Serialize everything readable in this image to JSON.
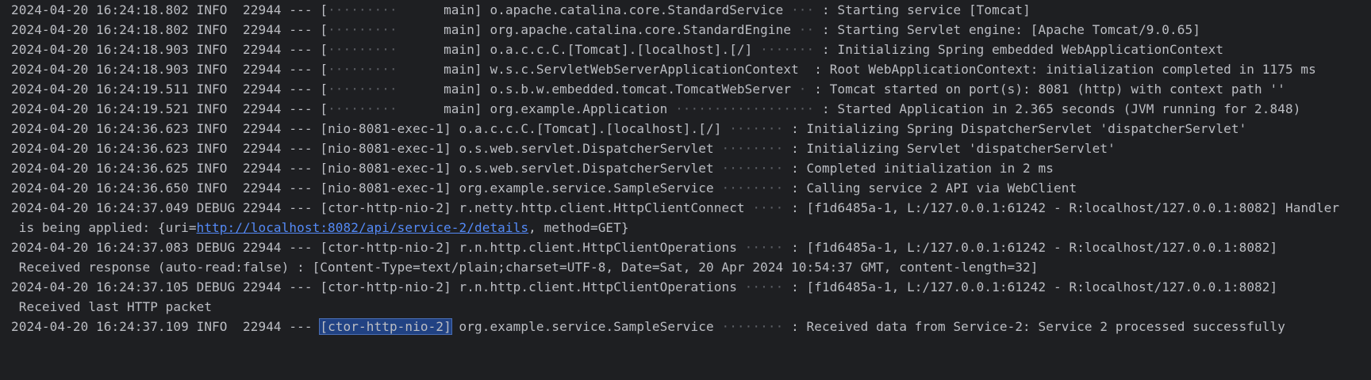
{
  "console": {
    "lines": [
      {
        "ts": "2024-04-20 16:24:18.802",
        "level": "INFO",
        "pid": "22944",
        "sep": "---",
        "thread_lead": "",
        "thread_dots": "·········",
        "thread": "main",
        "logger": "o.apache.catalina.core.StandardService",
        "logger_dots": "···",
        "msg": "Starting service [Tomcat]"
      },
      {
        "ts": "2024-04-20 16:24:18.802",
        "level": "INFO",
        "pid": "22944",
        "sep": "---",
        "thread_lead": "",
        "thread_dots": "·········",
        "thread": "main",
        "logger": "org.apache.catalina.core.StandardEngine",
        "logger_dots": "··",
        "msg": "Starting Servlet engine: [Apache Tomcat/9.0.65]"
      },
      {
        "ts": "2024-04-20 16:24:18.903",
        "level": "INFO",
        "pid": "22944",
        "sep": "---",
        "thread_lead": "",
        "thread_dots": "·········",
        "thread": "main",
        "logger": "o.a.c.c.C.[Tomcat].[localhost].[/]",
        "logger_dots": "·······",
        "msg": "Initializing Spring embedded WebApplicationContext"
      },
      {
        "ts": "2024-04-20 16:24:18.903",
        "level": "INFO",
        "pid": "22944",
        "sep": "---",
        "thread_lead": "",
        "thread_dots": "·········",
        "thread": "main",
        "logger": "w.s.c.ServletWebServerApplicationContext",
        "logger_dots": "",
        "msg": "Root WebApplicationContext: initialization completed in 1175 ms"
      },
      {
        "ts": "2024-04-20 16:24:19.511",
        "level": "INFO",
        "pid": "22944",
        "sep": "---",
        "thread_lead": "",
        "thread_dots": "·········",
        "thread": "main",
        "logger": "o.s.b.w.embedded.tomcat.TomcatWebServer",
        "logger_dots": "·",
        "msg": "Tomcat started on port(s): 8081 (http) with context path ''"
      },
      {
        "ts": "2024-04-20 16:24:19.521",
        "level": "INFO",
        "pid": "22944",
        "sep": "---",
        "thread_lead": "",
        "thread_dots": "·········",
        "thread": "main",
        "logger": "org.example.Application",
        "logger_dots": "··················",
        "msg": "Started Application in 2.365 seconds (JVM running for 2.848)"
      },
      {
        "ts": "2024-04-20 16:24:36.623",
        "level": "INFO",
        "pid": "22944",
        "sep": "---",
        "thread_lead": "",
        "thread_dots": "",
        "thread": "nio-8081-exec-1",
        "logger": "o.a.c.c.C.[Tomcat].[localhost].[/]",
        "logger_dots": "·······",
        "msg": "Initializing Spring DispatcherServlet 'dispatcherServlet'"
      },
      {
        "ts": "2024-04-20 16:24:36.623",
        "level": "INFO",
        "pid": "22944",
        "sep": "---",
        "thread_lead": "",
        "thread_dots": "",
        "thread": "nio-8081-exec-1",
        "logger": "o.s.web.servlet.DispatcherServlet",
        "logger_dots": "········",
        "msg": "Initializing Servlet 'dispatcherServlet'"
      },
      {
        "ts": "2024-04-20 16:24:36.625",
        "level": "INFO",
        "pid": "22944",
        "sep": "---",
        "thread_lead": "",
        "thread_dots": "",
        "thread": "nio-8081-exec-1",
        "logger": "o.s.web.servlet.DispatcherServlet",
        "logger_dots": "········",
        "msg": "Completed initialization in 2 ms"
      },
      {
        "ts": "2024-04-20 16:24:36.650",
        "level": "INFO",
        "pid": "22944",
        "sep": "---",
        "thread_lead": "",
        "thread_dots": "",
        "thread": "nio-8081-exec-1",
        "logger": "org.example.service.SampleService",
        "logger_dots": "········",
        "msg": "Calling service 2 API via WebClient"
      },
      {
        "ts": "2024-04-20 16:24:37.049",
        "level": "DEBUG",
        "pid": "22944",
        "sep": "---",
        "thread_lead": "",
        "thread_dots": "",
        "thread": "ctor-http-nio-2",
        "logger": "r.netty.http.client.HttpClientConnect",
        "logger_dots": "····",
        "msg": "[f1d6485a-1, L:/127.0.0.1:61242 - R:localhost/127.0.0.1:8082] Handler"
      }
    ],
    "cont1_prefix": " is being applied: {uri=",
    "cont1_link": "http://localhost:8082/api/service-2/details",
    "cont1_suffix": ", method=GET}",
    "line12": {
      "ts": "2024-04-20 16:24:37.083",
      "level": "DEBUG",
      "pid": "22944",
      "sep": "---",
      "thread": "ctor-http-nio-2",
      "logger": "r.n.http.client.HttpClientOperations",
      "logger_dots": "·····",
      "msg": "[f1d6485a-1, L:/127.0.0.1:61242 - R:localhost/127.0.0.1:8082]"
    },
    "cont2": "Received response (auto-read:false) : [Content-Type=text/plain;charset=UTF-8, Date=Sat, 20 Apr 2024 10:54:37 GMT, content-length=32]",
    "line14": {
      "ts": "2024-04-20 16:24:37.105",
      "level": "DEBUG",
      "pid": "22944",
      "sep": "---",
      "thread": "ctor-http-nio-2",
      "logger": "r.n.http.client.HttpClientOperations",
      "logger_dots": "·····",
      "msg": "[f1d6485a-1, L:/127.0.0.1:61242 - R:localhost/127.0.0.1:8082]"
    },
    "cont3": "Received last HTTP packet",
    "line16": {
      "ts": "2024-04-20 16:24:37.109",
      "level": "INFO",
      "pid": "22944",
      "sep": "---",
      "thread": "ctor-http-nio-2",
      "logger": "org.example.service.SampleService",
      "logger_dots": "········",
      "msg": "Received data from Service-2: Service 2 processed successfully"
    },
    "colors": {
      "background": "#1e1f22",
      "text": "#bcbec4",
      "dots": "#5a5d63",
      "link": "#548af7",
      "selection": "#214283"
    }
  }
}
